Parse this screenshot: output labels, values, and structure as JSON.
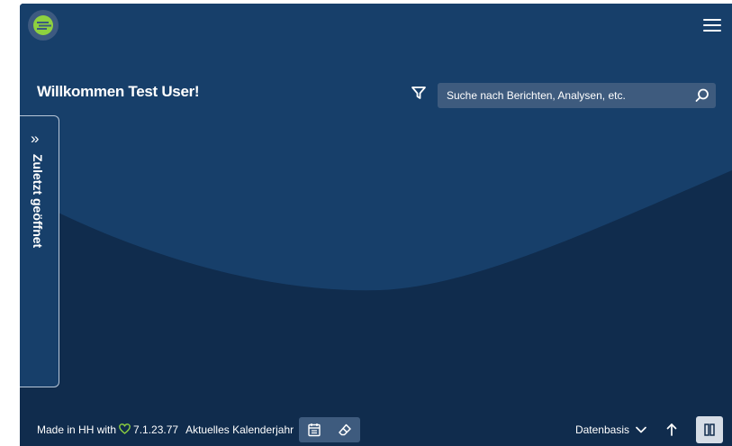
{
  "header": {
    "logo_icon": "brand-logo",
    "menu_icon": "hamburger-menu-icon"
  },
  "main": {
    "welcome": "Willkommen Test User!",
    "search_placeholder": "Suche nach Berichten, Analysen, etc."
  },
  "sidebar": {
    "tab_label": "Zuletzt geöffnet",
    "tab_icon": "double-chevron-right-icon"
  },
  "footer": {
    "made_in": "Made in HH with",
    "version": "7.1.23.77",
    "period": "Aktuelles Kalenderjahr",
    "datenbasis": "Datenbasis"
  },
  "colors": {
    "background": "#102c4d",
    "hero": "#173f6a",
    "search_bg": "#3e5b7e",
    "logo_green": "#8ed13f",
    "accent_heart": "#8ed13f"
  }
}
